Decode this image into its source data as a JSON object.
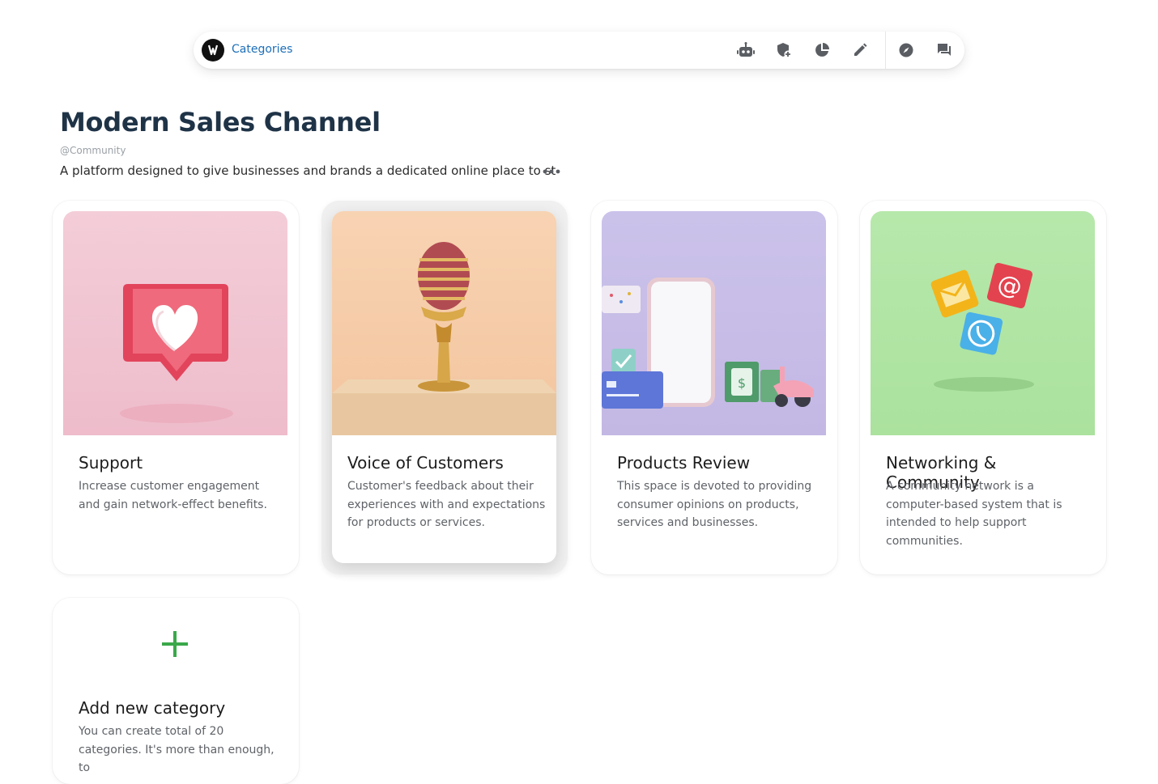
{
  "topbar": {
    "breadcrumb": "Categories",
    "icons": [
      "robot-icon",
      "shield-plus-icon",
      "pie-chart-icon",
      "pencil-icon",
      "compass-icon",
      "chat-icon"
    ]
  },
  "page": {
    "title": "Modern Sales Channel",
    "handle": "@Community",
    "description": "A platform designed to give businesses and brands a dedicated online place to st"
  },
  "cards": [
    {
      "title": "Support",
      "text": "Increase customer engagement and gain network-effect benefits.",
      "image": "pixel-heart-like-icon",
      "bg": "#f1c6d3"
    },
    {
      "title": "Voice of Customers",
      "text": "Customer's feedback about their experiences with and expectations for products or services.",
      "image": "golden-microphone",
      "bg": "#f6cfae"
    },
    {
      "title": "Products Review",
      "text": "This space is devoted to providing consumer opinions on products, services and businesses.",
      "image": "phone-money-scooter",
      "bg": "#c8bfe8"
    },
    {
      "title": "Networking & Community",
      "text": "A community network is a computer-based system that is intended to help support communities.",
      "image": "contact-cubes",
      "bg": "#b2e7a6"
    }
  ],
  "add_card": {
    "title": "Add new category",
    "text": "You can create total of 20 categories. It's more than enough, to"
  },
  "colors": {
    "accent": "#1c6fb8",
    "title": "#1f3347",
    "plus": "#3aa84a"
  }
}
